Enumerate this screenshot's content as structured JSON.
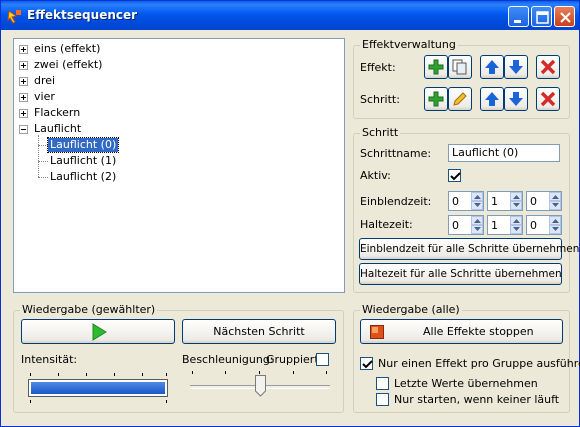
{
  "window": {
    "title": "Effektsequencer"
  },
  "tree": {
    "items": [
      {
        "label": "eins (effekt)",
        "expanded": false
      },
      {
        "label": "zwei (effekt)",
        "expanded": false
      },
      {
        "label": "drei",
        "expanded": false
      },
      {
        "label": "vier",
        "expanded": false
      },
      {
        "label": "Flackern",
        "expanded": false
      },
      {
        "label": "Lauflicht",
        "expanded": true
      }
    ],
    "children": [
      {
        "label": "Lauflicht (0)",
        "selected": true
      },
      {
        "label": "Lauflicht (1)",
        "selected": false
      },
      {
        "label": "Lauflicht (2)",
        "selected": false
      }
    ]
  },
  "effektverwaltung": {
    "title": "Effektverwaltung",
    "effekt_label": "Effekt:",
    "schritt_label": "Schritt:"
  },
  "schritt": {
    "title": "Schritt",
    "name_label": "Schrittname:",
    "name_value": "Lauflicht (0)",
    "aktiv_label": "Aktiv:",
    "aktiv_checked": true,
    "einblend_label": "Einblendzeit:",
    "einblend_values": [
      "0",
      "1",
      "0"
    ],
    "halte_label": "Haltezeit:",
    "halte_values": [
      "0",
      "1",
      "0"
    ],
    "btn_einblend_all": "Einblendzeit für alle Schritte übernehmen",
    "btn_halte_all": "Haltezeit für alle Schritte übernehmen"
  },
  "wiedergabe_gewaehlt": {
    "title": "Wiedergabe (gewählter)",
    "next_step": "Nächsten Schritt",
    "intensitaet_label": "Intensität:",
    "beschleunigung_label": "Beschleunigung:",
    "gruppiert_label": "Gruppiert",
    "gruppiert_checked": false,
    "intensitaet_level": 1.0,
    "beschleunigung_level": 0.5
  },
  "wiedergabe_alle": {
    "title": "Wiedergabe (alle)",
    "stop_all": "Alle Effekte stoppen",
    "opt_one_per_group": "Nur einen Effekt pro Gruppe ausführen",
    "opt_one_per_group_checked": true,
    "opt_last_values": "Letzte Werte übernehmen",
    "opt_last_values_checked": false,
    "opt_only_if_none": "Nur starten, wenn keiner läuft",
    "opt_only_if_none_checked": false
  },
  "colors": {
    "titlebar": "#0058ee",
    "selection": "#316ac5",
    "add": "#2fa32f",
    "arrow": "#1a64d8",
    "remove": "#d42a2a",
    "play": "#2fb92f",
    "stop": "#e0501a"
  }
}
